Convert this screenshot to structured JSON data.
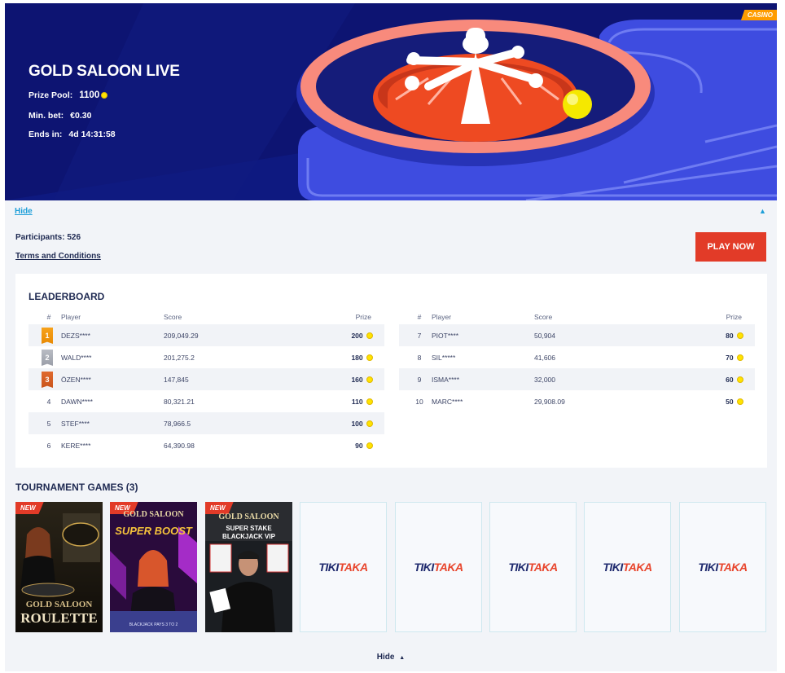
{
  "hero": {
    "title": "GOLD SALOON LIVE",
    "prize_pool_label": "Prize Pool:",
    "prize_pool_value": "1100",
    "min_bet_label": "Min. bet:",
    "min_bet_value": "€0.30",
    "ends_in_label": "Ends in:",
    "ends_in_value": "4d 14:31:58",
    "badge": "CASINO"
  },
  "details": {
    "hide_label": "Hide",
    "participants_label": "Participants:",
    "participants_value": "526",
    "terms_label": "Terms and Conditions",
    "play_button": "PLAY NOW"
  },
  "leaderboard": {
    "title": "LEADERBOARD",
    "headers": {
      "rank": "#",
      "player": "Player",
      "score": "Score",
      "prize": "Prize"
    },
    "rows": [
      {
        "rank": "1",
        "player": "DEZS****",
        "score": "209,049.29",
        "prize": "200",
        "medal": "gold"
      },
      {
        "rank": "2",
        "player": "WALD****",
        "score": "201,275.2",
        "prize": "180",
        "medal": "silver"
      },
      {
        "rank": "3",
        "player": "ÖZEN****",
        "score": "147,845",
        "prize": "160",
        "medal": "bronze"
      },
      {
        "rank": "4",
        "player": "DAWN****",
        "score": "80,321.21",
        "prize": "110"
      },
      {
        "rank": "5",
        "player": "STEF****",
        "score": "78,966.5",
        "prize": "100"
      },
      {
        "rank": "6",
        "player": "KERE****",
        "score": "64,390.98",
        "prize": "90"
      },
      {
        "rank": "7",
        "player": "PIOT****",
        "score": "50,904",
        "prize": "80"
      },
      {
        "rank": "8",
        "player": "SIL*****",
        "score": "41,606",
        "prize": "70"
      },
      {
        "rank": "9",
        "player": "ISMA****",
        "score": "32,000",
        "prize": "60"
      },
      {
        "rank": "10",
        "player": "MARC****",
        "score": "29,908.09",
        "prize": "50"
      }
    ]
  },
  "games": {
    "title": "TOURNAMENT GAMES (3)",
    "new_tag": "NEW",
    "items": [
      {
        "name": "GOLD SALOON ROULETTE",
        "line1": "GOLD SALOON",
        "line2": "ROULETTE"
      },
      {
        "name": "GOLD SALOON SUPER BOOST",
        "line1": "GOLD SALOON",
        "line2": "SUPER BOOST",
        "line3": "BLACKJACK PAYS 3 TO 2"
      },
      {
        "name": "GOLD SALOON SUPER STAKE BLACKJACK VIP",
        "line1": "GOLD SALOON",
        "line2": "SUPER STAKE",
        "line3": "BLACKJACK VIP"
      }
    ],
    "placeholder_logo_a": "TIKI",
    "placeholder_logo_b": "TAKA"
  },
  "footer": {
    "hide_label": "Hide",
    "caret": "▲"
  }
}
